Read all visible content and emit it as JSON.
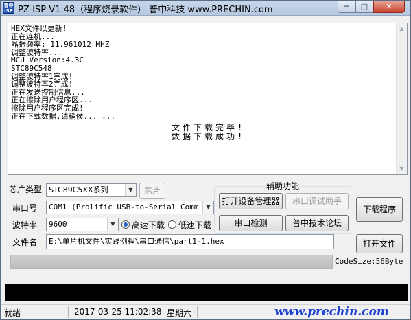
{
  "window": {
    "icon_text": "普中ISP",
    "title": "PZ-ISP V1.48（程序烧录软件）   普中科技  www.PRECHIN.com",
    "btn_min": "─",
    "btn_max": "□",
    "btn_close": "✕"
  },
  "log": {
    "lines": [
      "HEX文件以更新!",
      "正在连机...",
      "晶振频率: 11.961012 MHZ",
      "调整波特率...",
      "MCU Version:4.3C",
      "STC89C548",
      "调整波特率1完成!",
      "调整波特率2完成!",
      "正在发送控制信息...",
      "正在擦除用户程序区...",
      "擦除用户程序区完成!",
      "正在下载数据,请稍侯... ..."
    ],
    "result_line1": "文件下载完毕!",
    "result_line2": "数据下载成功!"
  },
  "form": {
    "chip_type_label": "芯片类型",
    "chip_type_value": "STC89C5XX系列",
    "chip_button": "芯片",
    "port_label": "串口号",
    "port_value": "COM1 (Prolific USB-to-Serial Comm Por",
    "baud_label": "波特率",
    "baud_value": "9600",
    "radio_high": "高速下载",
    "radio_low": "低速下载",
    "filename_label": "文件名",
    "filename_value": "E:\\单片机文件\\实践例程\\串口通信\\part1-1.hex"
  },
  "aux": {
    "title": "辅助功能",
    "device_manager": "打开设备管理器",
    "serial_assistant": "串口调试助手",
    "port_detect": "串口检测",
    "forum": "普中技术论坛"
  },
  "actions": {
    "download": "下载程序",
    "open_file": "打开文件"
  },
  "progress": {
    "fraction": 1.0,
    "codesize": "CodeSize:56Byte"
  },
  "status": {
    "state": "就绪",
    "datetime": "2017-03-25  11:02:38",
    "weekday": "星期六",
    "brand": "www.prechin.com"
  }
}
